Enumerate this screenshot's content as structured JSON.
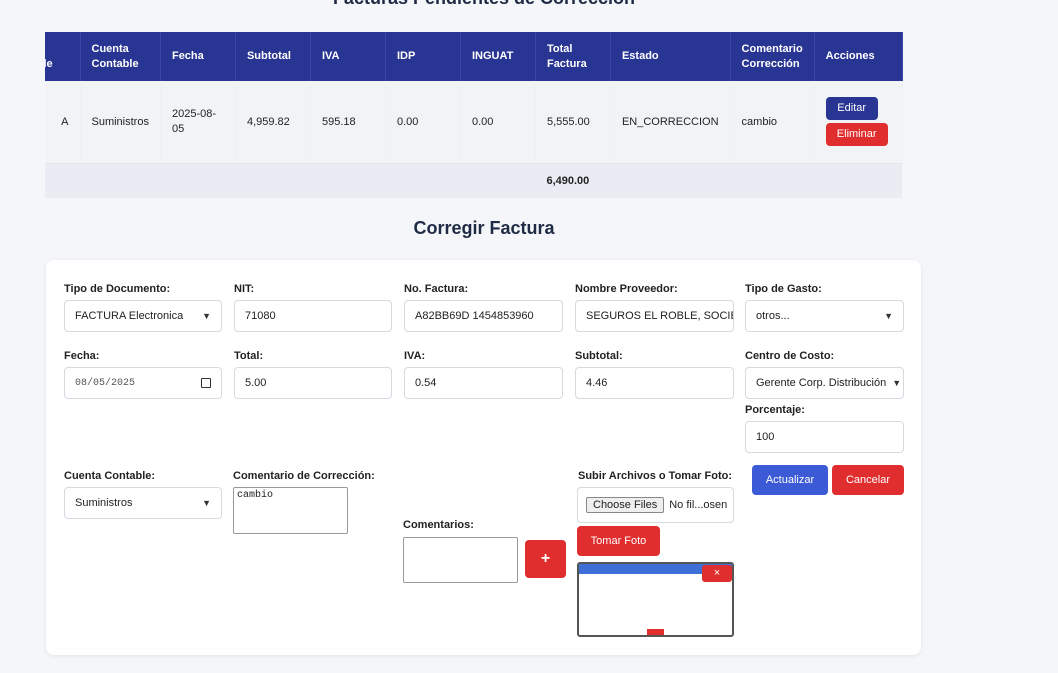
{
  "page": {
    "pending_title": "Facturas Pendientes de Corrección",
    "form_title": "Corregir Factura"
  },
  "table": {
    "headers": [
      "Tipo de Combustible",
      "Cuenta Contable",
      "Fecha",
      "Subtotal",
      "IVA",
      "IDP",
      "INGUAT",
      "Total Factura",
      "Estado",
      "Comentario Corrección",
      "Acciones"
    ],
    "row": {
      "combustible": "A",
      "cuenta": "Suministros",
      "fecha": "2025-08-05",
      "subtotal": "4,959.82",
      "iva": "595.18",
      "idp": "0.00",
      "inguat": "0.00",
      "total": "5,555.00",
      "estado": "EN_CORRECCION",
      "comentario": "cambio",
      "edit_label": "Editar",
      "delete_label": "Eliminar"
    },
    "grand_total": "6,490.00"
  },
  "form": {
    "tipo_documento": {
      "label": "Tipo de Documento:",
      "value": "FACTURA Electronica"
    },
    "nit": {
      "label": "NIT:",
      "value": "71080"
    },
    "no_factura": {
      "label": "No. Factura:",
      "value": "A82BB69D 1454853960"
    },
    "nombre_proveedor": {
      "label": "Nombre Proveedor:",
      "value": "SEGUROS EL ROBLE, SOCIEDAD ANONIMA"
    },
    "tipo_gasto": {
      "label": "Tipo de Gasto:",
      "value": "otros..."
    },
    "fecha": {
      "label": "Fecha:",
      "value": "08/05/2025"
    },
    "total": {
      "label": "Total:",
      "value": "5.00"
    },
    "iva": {
      "label": "IVA:",
      "value": "0.54"
    },
    "subtotal": {
      "label": "Subtotal:",
      "value": "4.46"
    },
    "centro_costo": {
      "label": "Centro de Costo:",
      "value": "Gerente Corp. Distribución"
    },
    "porcentaje": {
      "label": "Porcentaje:",
      "value": "100"
    },
    "cuenta_contable": {
      "label": "Cuenta Contable:",
      "value": "Suministros"
    },
    "comentario_correccion": {
      "label": "Comentario de Corrección:",
      "value": "cambio"
    },
    "comentarios": {
      "label": "Comentarios:",
      "value": ""
    },
    "add_button": "+",
    "archivos": {
      "label": "Subir Archivos o Tomar Foto:",
      "button": "Choose Files",
      "status": "No fil...osen"
    },
    "tomar_foto": "Tomar Foto",
    "preview_close": "×",
    "actualizar": "Actualizar",
    "cancelar": "Cancelar"
  },
  "colors": {
    "header_bg": "#283593",
    "primary_blue": "#3d5ad6",
    "danger_red": "#e02d2d"
  }
}
